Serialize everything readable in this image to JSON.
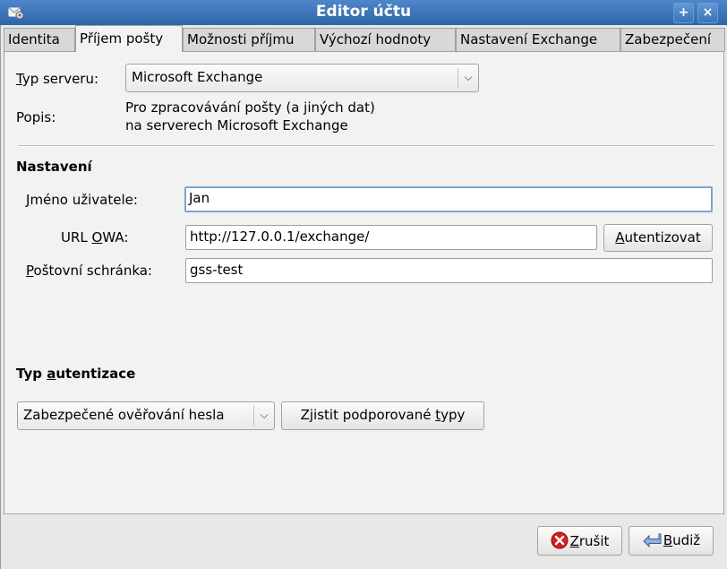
{
  "window": {
    "title": "Editor účtu"
  },
  "tabs": [
    {
      "label": "Identita"
    },
    {
      "label": "Příjem pošty"
    },
    {
      "label": "Možnosti příjmu"
    },
    {
      "label": "Výchozí hodnoty"
    },
    {
      "label": "Nastavení Exchange"
    },
    {
      "label": "Zabezpečení"
    }
  ],
  "active_tab": "Příjem pošty",
  "server": {
    "type_label_u": "T",
    "type_label_rest": "yp serveru:",
    "type_value": "Microsoft Exchange",
    "desc_label": "Popis:",
    "desc_line1": "Pro zpracovávání pošty (a jiných dat)",
    "desc_line2": "na serverech Microsoft Exchange"
  },
  "settings": {
    "heading": "Nastavení",
    "username_label_u": "J",
    "username_label_rest": "méno uživatele:",
    "username_value": "Jan",
    "owa_label_pre": "URL ",
    "owa_label_u": "O",
    "owa_label_rest": "WA:",
    "owa_value": "http://127.0.0.1/exchange/",
    "auth_button_u": "A",
    "auth_button_rest": "utentizovat",
    "mailbox_label_u": "P",
    "mailbox_label_rest": "oštovní schránka:",
    "mailbox_value": "gss-test"
  },
  "auth": {
    "heading_pre": "Typ ",
    "heading_u": "a",
    "heading_rest": "utentizace",
    "type_value": "Zabezpečené ověřování hesla",
    "detect_button_pre": "Zjistit podporované ",
    "detect_button_u": "t",
    "detect_button_rest": "ypy"
  },
  "footer": {
    "cancel_u": "Z",
    "cancel_rest": "rušit",
    "back_u": "B",
    "back_rest": "udiž"
  },
  "colors": {
    "titlebar": "#3a70b3",
    "panel": "#f2f2f1",
    "focus": "#7fa3d3"
  }
}
